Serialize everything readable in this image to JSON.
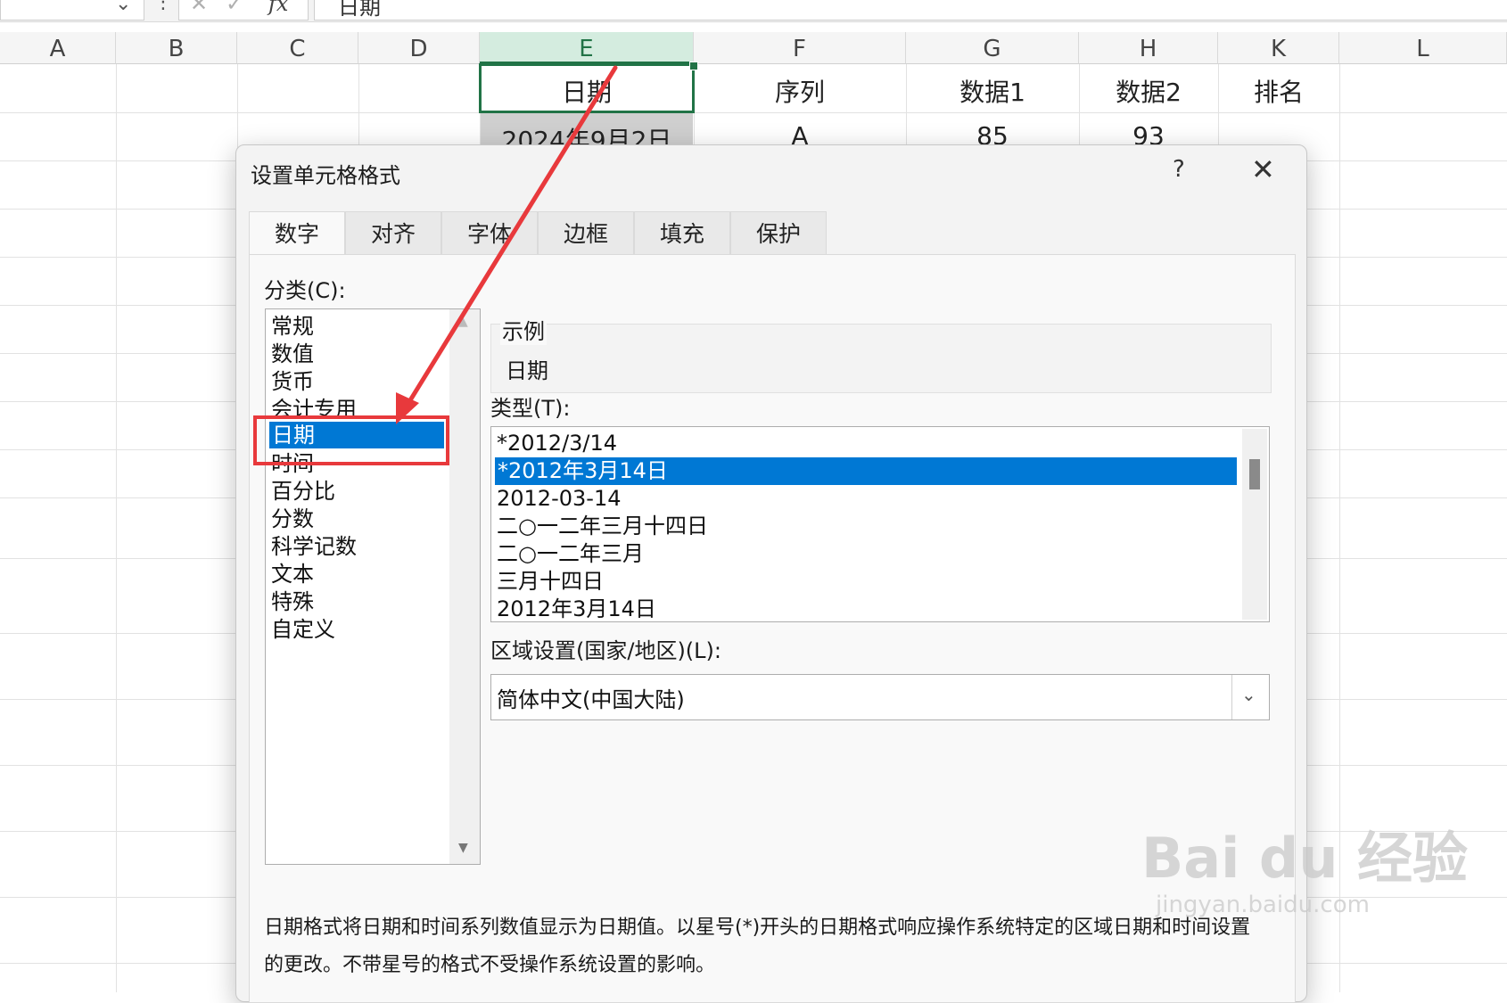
{
  "formula_bar": {
    "fx_label": "fx",
    "content": "日期",
    "cancel_glyph": "✕",
    "confirm_glyph": "✓"
  },
  "columns": [
    "A",
    "B",
    "C",
    "D",
    "E",
    "F",
    "G",
    "H",
    "K",
    "L"
  ],
  "rows": [
    {
      "E": "日期",
      "F": "序列",
      "G": "数据1",
      "H": "数据2",
      "K": "排名"
    },
    {
      "E": "2024年9月2日",
      "F": "A",
      "G": "85",
      "H": "93",
      "K": ""
    }
  ],
  "dialog": {
    "title": "设置单元格格式",
    "help": "?",
    "close": "✕",
    "tabs": [
      "数字",
      "对齐",
      "字体",
      "边框",
      "填充",
      "保护"
    ],
    "category_label": "分类(C):",
    "categories": [
      "常规",
      "数值",
      "货币",
      "会计专用",
      "日期",
      "时间",
      "百分比",
      "分数",
      "科学记数",
      "文本",
      "特殊",
      "自定义"
    ],
    "selected_category": "日期",
    "sample_label": "示例",
    "sample_value": "日期",
    "type_label": "类型(T):",
    "types": [
      "*2012/3/14",
      "*2012年3月14日",
      "2012-03-14",
      "二○一二年三月十四日",
      "二○一二年三月",
      "三月十四日",
      "2012年3月14日"
    ],
    "selected_type": "*2012年3月14日",
    "locale_label": "区域设置(国家/地区)(L):",
    "locale_value": "简体中文(中国大陆)",
    "description": "日期格式将日期和时间系列数值显示为日期值。以星号(*)开头的日期格式响应操作系统特定的区域日期和时间设置的更改。不带星号的格式不受操作系统设置的影响。"
  },
  "watermark": {
    "brand": "Bai du 经验",
    "url": "jingyan.baidu.com"
  },
  "colors": {
    "accent": "#217346",
    "selection": "#0078d4",
    "annotation": "#e8393c"
  }
}
